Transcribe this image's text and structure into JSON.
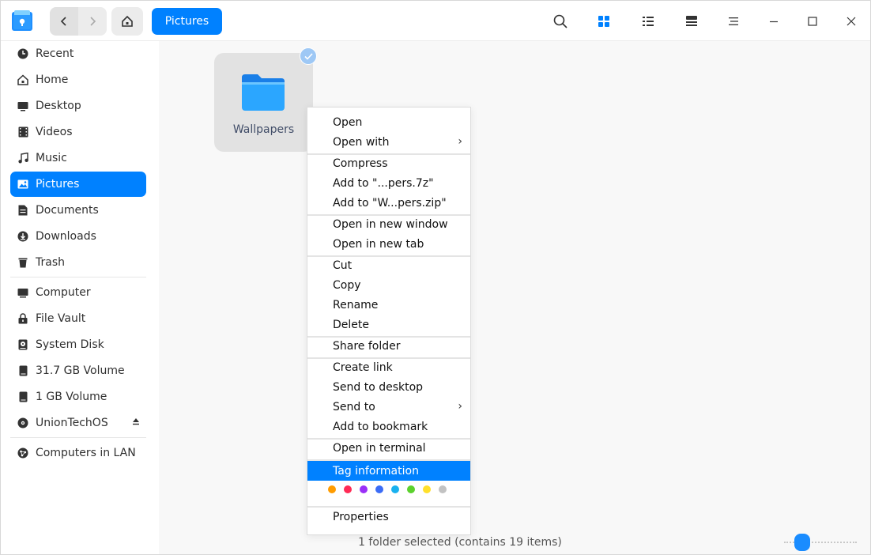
{
  "titlebar": {
    "breadcrumb": "Pictures",
    "icons": [
      "back-icon",
      "forward-icon",
      "home-icon",
      "search-icon",
      "icon-view-icon",
      "list-view-icon",
      "tree-view-icon",
      "menu-icon",
      "minimize-icon",
      "maximize-icon",
      "close-icon"
    ]
  },
  "sidebar": {
    "items": [
      {
        "label": "Recent",
        "icon": "clock-icon"
      },
      {
        "label": "Home",
        "icon": "home-icon"
      },
      {
        "label": "Desktop",
        "icon": "desktop-icon"
      },
      {
        "label": "Videos",
        "icon": "video-icon"
      },
      {
        "label": "Music",
        "icon": "music-icon"
      },
      {
        "label": "Pictures",
        "icon": "picture-icon",
        "active": true
      },
      {
        "label": "Documents",
        "icon": "document-icon"
      },
      {
        "label": "Downloads",
        "icon": "download-icon"
      },
      {
        "label": "Trash",
        "icon": "trash-icon"
      },
      {
        "label": "Computer",
        "icon": "computer-icon"
      },
      {
        "label": "File Vault",
        "icon": "lock-icon"
      },
      {
        "label": "System Disk",
        "icon": "disk-icon"
      },
      {
        "label": "31.7 GB Volume",
        "icon": "drive-icon"
      },
      {
        "label": "1 GB Volume",
        "icon": "drive-icon"
      },
      {
        "label": "UnionTechOS",
        "icon": "disc-icon"
      },
      {
        "label": "Computers in LAN",
        "icon": "network-icon"
      }
    ]
  },
  "main": {
    "folder_name": "Wallpapers",
    "status": "1 folder selected (contains 19 items)"
  },
  "context_menu": {
    "items": [
      {
        "label": "Open"
      },
      {
        "label": "Open with",
        "submenu": true
      },
      {
        "label": "Compress"
      },
      {
        "label": "Add to \"...pers.7z\""
      },
      {
        "label": "Add to \"W...pers.zip\""
      },
      {
        "label": "Open in new window"
      },
      {
        "label": "Open in new tab"
      },
      {
        "label": "Cut"
      },
      {
        "label": "Copy"
      },
      {
        "label": "Rename"
      },
      {
        "label": "Delete"
      },
      {
        "label": "Share folder"
      },
      {
        "label": "Create link"
      },
      {
        "label": "Send to desktop"
      },
      {
        "label": "Send to",
        "submenu": true
      },
      {
        "label": "Add to bookmark"
      },
      {
        "label": "Open in terminal"
      },
      {
        "label": "Tag information",
        "highlighted": true
      },
      {
        "label": "Properties"
      }
    ],
    "submenu_arrow": "›",
    "tag_colors": [
      "#ff9c00",
      "#ff2a55",
      "#9a2ff7",
      "#3b6cf6",
      "#19b1ef",
      "#5bd12d",
      "#ffe02b",
      "#c2c2c2"
    ]
  },
  "colors": {
    "accent": "#0081ff"
  }
}
